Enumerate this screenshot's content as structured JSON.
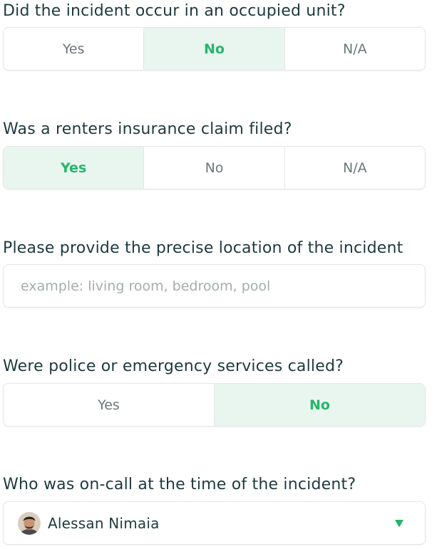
{
  "questions": [
    {
      "label": "Did the incident occur in an occupied unit?",
      "options": [
        "Yes",
        "No",
        "N/A"
      ],
      "selected": "No"
    },
    {
      "label": "Was a renters insurance claim filed?",
      "options": [
        "Yes",
        "No",
        "N/A"
      ],
      "selected": "Yes"
    },
    {
      "label": "Please provide the precise location of the incident",
      "placeholder": "example: living room, bedroom, pool",
      "value": ""
    },
    {
      "label": "Were police or emergency services called?",
      "options": [
        "Yes",
        "No"
      ],
      "selected": "No"
    },
    {
      "label": "Who was on-call at the time of the incident?",
      "selected_value": "Alessan Nimaia",
      "icons": {
        "avatar": "avatar-photo",
        "dropdown": "caret-down-icon"
      }
    }
  ],
  "colors": {
    "accent": "#27b56a",
    "selected_bg": "#e8f6ef",
    "text": "#1e3a3e",
    "muted": "#6b7779",
    "border": "#e3e7e8"
  }
}
